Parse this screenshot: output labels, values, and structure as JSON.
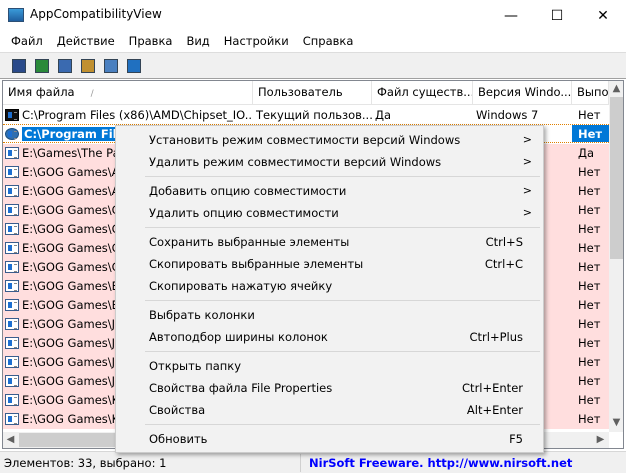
{
  "window": {
    "title": "AppCompatibilityView",
    "min": "—",
    "max": "☐",
    "close": "✕"
  },
  "menubar": [
    "Файл",
    "Действие",
    "Правка",
    "Вид",
    "Настройки",
    "Справка"
  ],
  "toolbar": [
    "save-icon",
    "refresh-icon",
    "copy-icon",
    "properties-icon",
    "find-icon",
    "exit-icon"
  ],
  "columns": [
    "Имя файла",
    "Пользователь",
    "Файл существ...",
    "Версия Windo...",
    "Выпо"
  ],
  "sort_indicator": "/",
  "rows": [
    {
      "name": "C:\\Program Files (x86)\\AMD\\Chipset_IO...",
      "user": "Текущий пользов...",
      "exists": "Да",
      "version": "Windows 7",
      "run": "Нет",
      "pink": false,
      "selected": false
    },
    {
      "name": "C:\\Program Files",
      "user": "",
      "exists": "",
      "version": "",
      "run": "Нет",
      "pink": false,
      "selected": true
    },
    {
      "name": "E:\\Games\\The Pa",
      "run": "Да",
      "pink": true
    },
    {
      "name": "E:\\GOG Games\\A",
      "run": "Нет",
      "pink": true
    },
    {
      "name": "E:\\GOG Games\\A",
      "run": "Нет",
      "pink": true
    },
    {
      "name": "E:\\GOG Games\\C",
      "run": "Нет",
      "pink": true
    },
    {
      "name": "E:\\GOG Games\\C",
      "run": "Нет",
      "pink": true
    },
    {
      "name": "E:\\GOG Games\\C",
      "run": "Нет",
      "pink": true
    },
    {
      "name": "E:\\GOG Games\\C",
      "run": "Нет",
      "pink": true
    },
    {
      "name": "E:\\GOG Games\\E",
      "run": "Нет",
      "pink": true
    },
    {
      "name": "E:\\GOG Games\\E",
      "run": "Нет",
      "pink": true
    },
    {
      "name": "E:\\GOG Games\\Jo",
      "run": "Нет",
      "pink": true
    },
    {
      "name": "E:\\GOG Games\\Jo",
      "run": "Нет",
      "pink": true
    },
    {
      "name": "E:\\GOG Games\\Jo",
      "run": "Нет",
      "pink": true
    },
    {
      "name": "E:\\GOG Games\\Jo",
      "run": "Нет",
      "pink": true
    },
    {
      "name": "E:\\GOG Games\\K",
      "run": "Нет",
      "pink": true
    },
    {
      "name": "E:\\GOG Games\\K",
      "run": "Нет",
      "pink": true
    }
  ],
  "context_menu": [
    {
      "label": "Установить режим совместимости версий Windows",
      "submenu": true
    },
    {
      "label": "Удалить режим совместимости версий Windows",
      "submenu": true
    },
    {
      "sep": true
    },
    {
      "label": "Добавить опцию совместимости",
      "submenu": true
    },
    {
      "label": "Удалить опцию совместимости",
      "submenu": true
    },
    {
      "sep": true
    },
    {
      "label": "Сохранить выбранные элементы",
      "shortcut": "Ctrl+S"
    },
    {
      "label": "Скопировать выбранные элементы",
      "shortcut": "Ctrl+C"
    },
    {
      "label": "Скопировать нажатую ячейку"
    },
    {
      "sep": true
    },
    {
      "label": "Выбрать колонки"
    },
    {
      "label": "Автоподбор ширины колонок",
      "shortcut": "Ctrl+Plus"
    },
    {
      "sep": true
    },
    {
      "label": "Открыть папку"
    },
    {
      "label": "Свойства файла File Properties",
      "shortcut": "Ctrl+Enter"
    },
    {
      "label": "Свойства",
      "shortcut": "Alt+Enter"
    },
    {
      "sep": true
    },
    {
      "label": "Обновить",
      "shortcut": "F5"
    }
  ],
  "submenu_arrow": ">",
  "status": {
    "left": "Элементов: 33, выбрано: 1",
    "right": "NirSoft Freeware.  http://www.nirsoft.net",
    "link_color": "#0000ff"
  }
}
